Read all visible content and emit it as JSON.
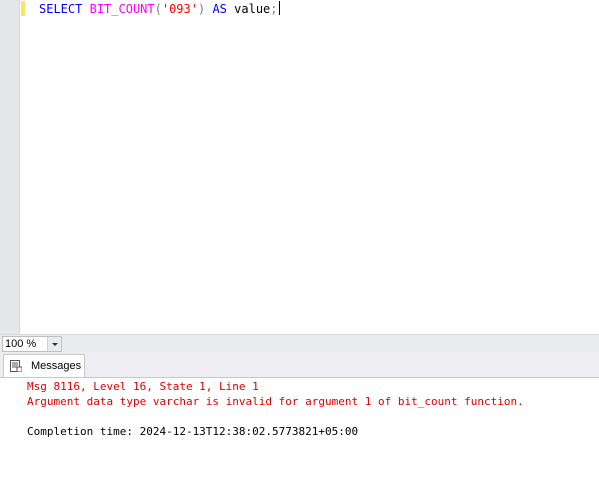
{
  "editor": {
    "query": {
      "kw_select": "SELECT",
      "fn_name": "BIT_COUNT",
      "paren_open": "(",
      "arg": "'093'",
      "paren_close": ")",
      "kw_as": "AS",
      "alias": "value",
      "semicolon": ";"
    }
  },
  "statusbar": {
    "zoom": "100 %"
  },
  "results": {
    "tab_label": "Messages",
    "error_line1": "Msg 8116, Level 16, State 1, Line 1",
    "error_line2": "Argument data type varchar is invalid for argument 1 of bit_count function.",
    "completion": "Completion time: 2024-12-13T12:38:02.5773821+05:00"
  },
  "colors": {
    "keyword": "#0000ff",
    "function": "#ff00ff",
    "string": "#ff0000",
    "operator": "#808080",
    "error": "#e00000"
  }
}
